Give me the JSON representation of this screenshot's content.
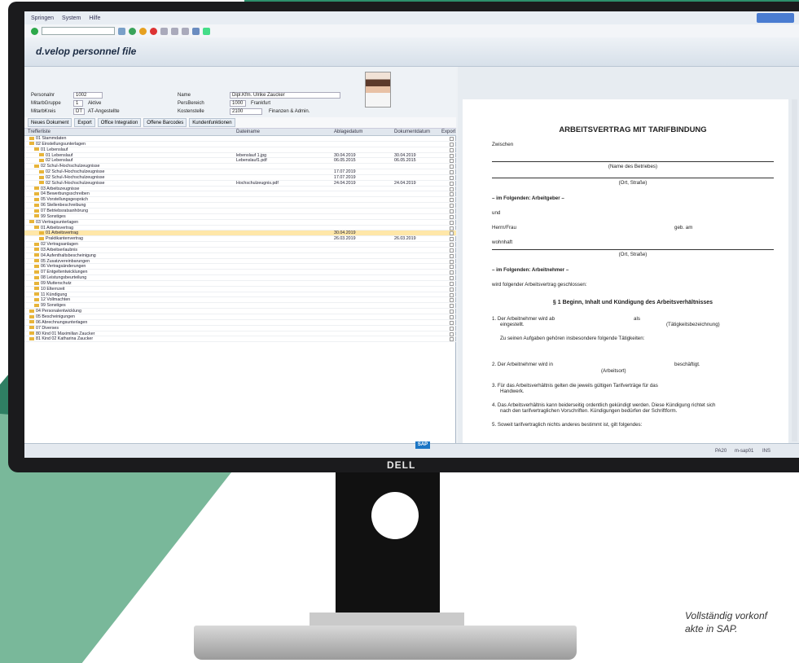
{
  "colors": {
    "sap_blue": "#1c76c5",
    "folder": "#e7b43a",
    "selection": "#ffe7a8",
    "green_dark": "#2f7f63",
    "green_light": "#79b89a"
  },
  "menu": [
    "Springen",
    "System",
    "Hilfe"
  ],
  "window_title": "d.velop personnel file",
  "header": {
    "personalnr_label": "Personalnr",
    "personalnr": "1002",
    "mitarbgruppe_label": "MitarbGruppe",
    "mitarbgruppe_code": "1",
    "mitarbgruppe": "Aktive",
    "mitarbkreis_label": "MitarbKreis",
    "mitarbkreis_code": "DT",
    "mitarbkreis": "AT-Angestellte",
    "name_label": "Name",
    "name": "Dipl.Kfm. Ulrike Zaucker",
    "persbereich_label": "PersBereich",
    "persbereich_code": "1000",
    "persbereich": "Frankfurt",
    "kostenstelle_label": "Kostenstelle",
    "kostenstelle_code": "2100",
    "kostenstelle": "Finanzen & Admin."
  },
  "buttons": [
    "Neues Dokument",
    "Export",
    "Office Integration",
    "Offene Barcodes",
    "Kundenfunktionen"
  ],
  "columns": [
    "Trefferliste",
    "Dateiname",
    "Ablagedatum",
    "Dokumentdatum",
    "Export"
  ],
  "rows": [
    {
      "name": "01 Stammdaten",
      "file": "",
      "d1": "",
      "d2": ""
    },
    {
      "name": "02 Einstellungsunterlagen",
      "file": "",
      "d1": "",
      "d2": ""
    },
    {
      "name": "01 Lebenslauf",
      "file": "",
      "d1": "",
      "d2": ""
    },
    {
      "name": "01 Lebenslauf",
      "file": "lebenslauf 1.jpg",
      "d1": "30.04.2019",
      "d2": "30.04.2019"
    },
    {
      "name": "02 Lebenslauf",
      "file": "Lebenslauf1.pdf",
      "d1": "06.05.2015",
      "d2": "06.05.2015"
    },
    {
      "name": "02 Schul-/Hochschulzeugnisse",
      "file": "",
      "d1": "",
      "d2": ""
    },
    {
      "name": "02 Schul-/Hochschulzeugnisse",
      "file": "",
      "d1": "17.07.2019",
      "d2": ""
    },
    {
      "name": "02 Schul-/Hochschulzeugnisse",
      "file": "",
      "d1": "17.07.2019",
      "d2": ""
    },
    {
      "name": "02 Schul-/Hochschulzeugnisse",
      "file": "Hochschulzeugnis.pdf",
      "d1": "24.04.2019",
      "d2": "24.04.2019"
    },
    {
      "name": "03 Arbeitszeugnisse",
      "file": "",
      "d1": "",
      "d2": ""
    },
    {
      "name": "04 Bewerbungsschreiben",
      "file": "",
      "d1": "",
      "d2": ""
    },
    {
      "name": "05 Vorstellungsgespräch",
      "file": "",
      "d1": "",
      "d2": ""
    },
    {
      "name": "06 Stellenbeschreibung",
      "file": "",
      "d1": "",
      "d2": ""
    },
    {
      "name": "07 Betriebsratsanhörung",
      "file": "",
      "d1": "",
      "d2": ""
    },
    {
      "name": "99 Sonstiges",
      "file": "",
      "d1": "",
      "d2": ""
    },
    {
      "name": "03 Vertragsunterlagen",
      "file": "",
      "d1": "",
      "d2": ""
    },
    {
      "name": "01 Arbeitsvertrag",
      "file": "",
      "d1": "",
      "d2": ""
    },
    {
      "name": "01 Arbeitsvertrag",
      "file": "",
      "d1": "30.04.2019",
      "d2": "",
      "sel": true
    },
    {
      "name": "Praktikantenvertrag",
      "file": "",
      "d1": "26.03.2019",
      "d2": "26.03.2019"
    },
    {
      "name": "02 Vertragsanlagen",
      "file": "",
      "d1": "",
      "d2": ""
    },
    {
      "name": "03 Arbeitserlaubnis",
      "file": "",
      "d1": "",
      "d2": ""
    },
    {
      "name": "04 Aufenthaltsbescheinigung",
      "file": "",
      "d1": "",
      "d2": ""
    },
    {
      "name": "05 Zusatzvereinbarungen",
      "file": "",
      "d1": "",
      "d2": ""
    },
    {
      "name": "06 Vertragsänderungen",
      "file": "",
      "d1": "",
      "d2": ""
    },
    {
      "name": "07 Entgeltentwicklungen",
      "file": "",
      "d1": "",
      "d2": ""
    },
    {
      "name": "08 Leistungsbeurteilung",
      "file": "",
      "d1": "",
      "d2": ""
    },
    {
      "name": "09 Mutterschutz",
      "file": "",
      "d1": "",
      "d2": ""
    },
    {
      "name": "10 Elternzeit",
      "file": "",
      "d1": "",
      "d2": ""
    },
    {
      "name": "11 Kündigung",
      "file": "",
      "d1": "",
      "d2": ""
    },
    {
      "name": "12 Vollmachten",
      "file": "",
      "d1": "",
      "d2": ""
    },
    {
      "name": "99 Sonstiges",
      "file": "",
      "d1": "",
      "d2": ""
    },
    {
      "name": "04 Personalentwicklung",
      "file": "",
      "d1": "",
      "d2": ""
    },
    {
      "name": "05 Bescheinigungen",
      "file": "",
      "d1": "",
      "d2": ""
    },
    {
      "name": "06 Abrechnungsunterlagen",
      "file": "",
      "d1": "",
      "d2": ""
    },
    {
      "name": "07 Diverses",
      "file": "",
      "d1": "",
      "d2": ""
    },
    {
      "name": "80 Kind 01 Maximilian Zaucker",
      "file": "",
      "d1": "",
      "d2": ""
    },
    {
      "name": "81 Kind 02 Katharina Zaucker",
      "file": "",
      "d1": "",
      "d2": ""
    }
  ],
  "document": {
    "title": "ARBEITSVERTRAG MIT TARIFBINDUNG",
    "zwischen": "Zwischen",
    "betrieb": "(Name des Betriebes)",
    "ort1": "(Ort, Straße)",
    "arbeitgeber": "– im Folgenden: Arbeitgeber –",
    "und": "und",
    "herr_frau": "Herrn/Frau",
    "geb_am": "geb. am",
    "wohnhaft": "wohnhaft",
    "ort2": "(Ort, Straße)",
    "arbeitnehmer": "– im Folgenden: Arbeitnehmer –",
    "geschlossen": "wird folgender Arbeitsvertrag geschlossen:",
    "section": "§ 1 Beginn, Inhalt und Kündigung des Arbeitsverhältnisses",
    "p1": "1.  Der Arbeitnehmer wird ab",
    "p1_als": "als",
    "p1_eingestellt": "eingestellt.",
    "p1_tb": "(Tätigkeitsbezeichnung)",
    "p1_aufgaben": "Zu seinen Aufgaben gehören insbesondere folgende Tätigkeiten:",
    "p2": "2.  Der Arbeitnehmer wird in",
    "p2_b": "beschäftigt.",
    "p2_ort": "(Arbeitsort)",
    "p3": "3.  Für das Arbeitsverhältnis gelten die jeweils gültigen Tarifverträge für das",
    "p3b": "Handwerk.",
    "p4": "4.  Das Arbeitsverhältnis kann beiderseitig ordentlich gekündigt werden. Diese Kündigung richtet sich",
    "p4b": "nach den tarifvertraglichen Vorschriften. Kündigungen bedürfen der Schriftform.",
    "p5": "5.  Soweit tarifvertraglich nichts anderes bestimmt ist, gilt folgendes:"
  },
  "status": {
    "sap": "SAP",
    "session": "PA20",
    "server": "m-sap01",
    "client": "INS"
  },
  "monitor_brand": "DELL",
  "caption_line1": "Vollständig vorkonf",
  "caption_line2": "akte in SAP."
}
